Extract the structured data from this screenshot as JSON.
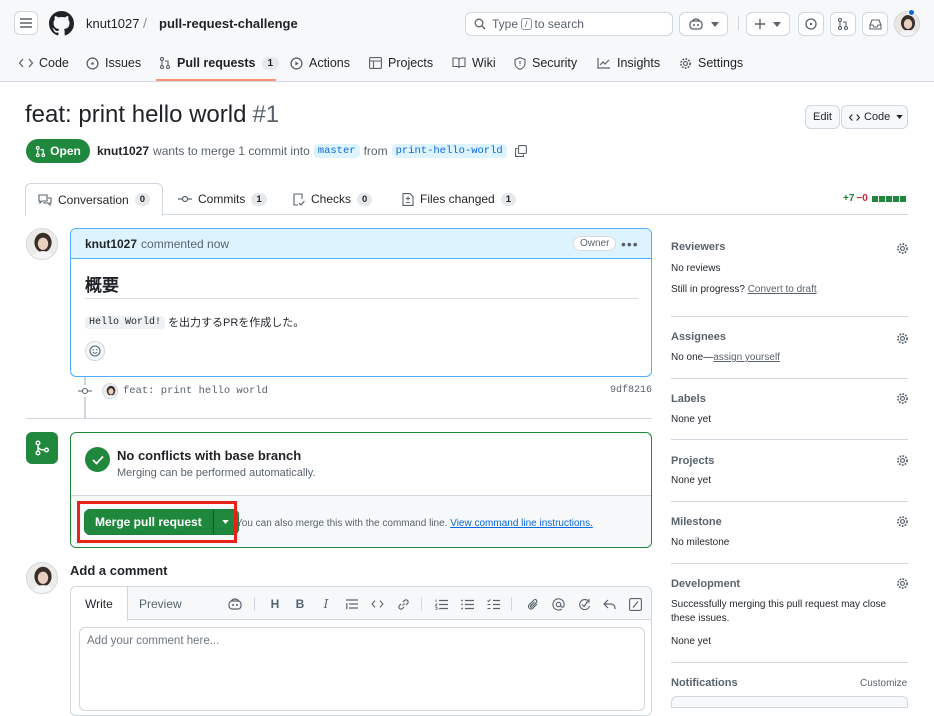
{
  "header": {
    "owner": "knut1027",
    "separator": "/",
    "repo": "pull-request-challenge",
    "search_prefix": "Type",
    "search_key": "/",
    "search_suffix": "to search"
  },
  "repo_nav": [
    {
      "label": "Code",
      "icon": "code-icon"
    },
    {
      "label": "Issues",
      "icon": "issue-icon"
    },
    {
      "label": "Pull requests",
      "icon": "pull-request-icon",
      "count": "1",
      "active": true
    },
    {
      "label": "Actions",
      "icon": "play-icon"
    },
    {
      "label": "Projects",
      "icon": "table-icon"
    },
    {
      "label": "Wiki",
      "icon": "book-icon"
    },
    {
      "label": "Security",
      "icon": "shield-icon"
    },
    {
      "label": "Insights",
      "icon": "graph-icon"
    },
    {
      "label": "Settings",
      "icon": "gear-icon"
    }
  ],
  "pr": {
    "title": "feat: print hello world",
    "number": "#1",
    "edit_label": "Edit",
    "code_label": "Code",
    "state": "Open",
    "author": "knut1027",
    "merge_text": "wants to merge 1 commit into",
    "base_branch": "master",
    "from_text": "from",
    "head_branch": "print-hello-world"
  },
  "tabs": [
    {
      "label": "Conversation",
      "count": "0"
    },
    {
      "label": "Commits",
      "count": "1"
    },
    {
      "label": "Checks",
      "count": "0"
    },
    {
      "label": "Files changed",
      "count": "1"
    }
  ],
  "diffstat": {
    "additions": "+7",
    "deletions": "−0"
  },
  "comment": {
    "author": "knut1027",
    "action": "commented now",
    "badge": "Owner",
    "heading": "概要",
    "code": "Hello World!",
    "text": "を出力するPRを作成した。"
  },
  "commit": {
    "message": "feat: print hello world",
    "sha": "9df8216"
  },
  "merge": {
    "title": "No conflicts with base branch",
    "subtitle": "Merging can be performed automatically.",
    "button": "Merge pull request",
    "hint": "You can also merge this with the command line.",
    "hint_link": "View command line instructions."
  },
  "add_comment": {
    "title": "Add a comment",
    "write_tab": "Write",
    "preview_tab": "Preview",
    "placeholder": "Add your comment here..."
  },
  "sidebar": {
    "reviewers": {
      "title": "Reviewers",
      "value": "No reviews",
      "draft_prefix": "Still in progress?",
      "draft_link": "Convert to draft"
    },
    "assignees": {
      "title": "Assignees",
      "value": "No one—",
      "link": "assign yourself"
    },
    "labels": {
      "title": "Labels",
      "value": "None yet"
    },
    "projects": {
      "title": "Projects",
      "value": "None yet"
    },
    "milestone": {
      "title": "Milestone",
      "value": "No milestone"
    },
    "development": {
      "title": "Development",
      "line1": "Successfully merging this pull request may close",
      "line2": "these issues.",
      "value": "None yet"
    },
    "notifications": {
      "title": "Notifications",
      "customize": "Customize"
    }
  },
  "colors": {
    "accent": "#0969da",
    "success": "#1f883d",
    "highlight": "#e8221b",
    "tab_underline": "#fd8c73"
  }
}
